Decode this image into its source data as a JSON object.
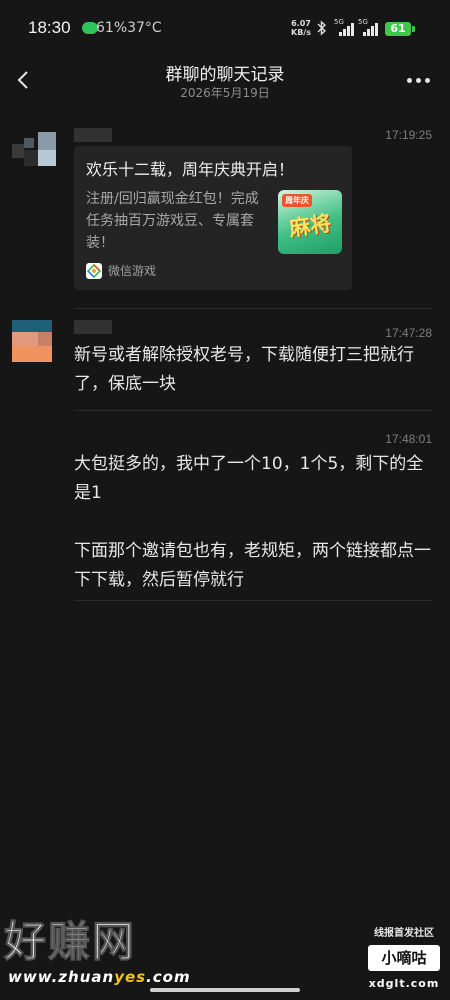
{
  "status_bar": {
    "time": "18:30",
    "extra": "61%37°C",
    "net_speed_value": "6.07",
    "net_speed_unit": "KB/s",
    "sim1_label": "5G",
    "sim2_label": "5G",
    "battery": "61",
    "colors": {
      "battery": "#3dc74c",
      "wechat": "#2fc25b"
    }
  },
  "header": {
    "title": "群聊的聊天记录",
    "date": "2026年5月19日"
  },
  "messages": [
    {
      "time": "17:19:25",
      "card": {
        "title": "欢乐十二载，周年庆典开启！",
        "description": "注册/回归赢现金红包！完成任务抽百万游戏豆、专属套装！",
        "thumb_badge": "周年庆",
        "thumb_logo": "麻将",
        "source": "微信游戏",
        "source_icon": "wechat-game-icon"
      }
    },
    {
      "time": "17:47:28",
      "text": "新号或者解除授权老号，下载随便打三把就行了，保底一块"
    },
    {
      "time": "17:48:01",
      "text": "大包挺多的，我中了一个10，1个5，剩下的全是1\n\n下面那个邀请包也有，老规矩，两个链接都点一下下载，然后暂停就行"
    }
  ],
  "watermarks": {
    "left_big": "好赚网",
    "left_url_prefix": "www.zhuan",
    "left_url_highlight": "yes",
    "left_url_suffix": ".com",
    "right_top": "线报首发社区",
    "right_box": "小嘀咕",
    "right_url": "xdglt.com"
  }
}
